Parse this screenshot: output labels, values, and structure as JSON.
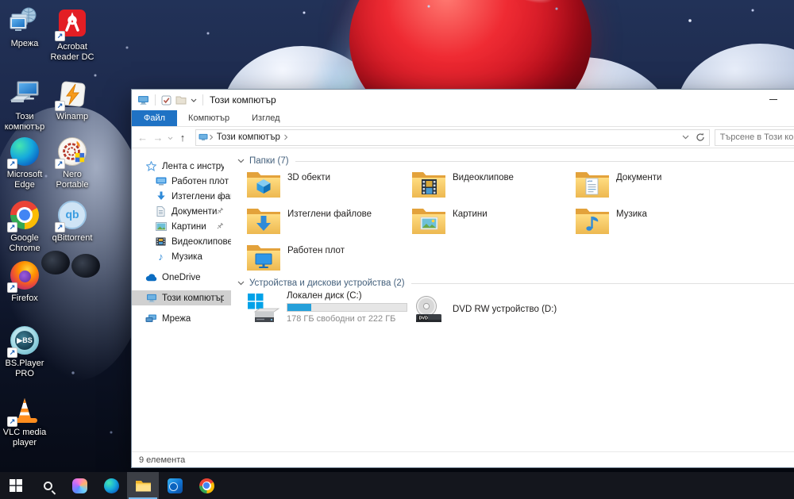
{
  "colors": {
    "accent_blue": "#1f72c4",
    "taskbar_bg": "#14161d",
    "selection_gray": "#d0d0d0",
    "disk_bar_fill": "#26a0da",
    "group_header_text": "#44607c"
  },
  "desktop": {
    "icons": [
      {
        "label": "Мрежа"
      },
      {
        "label": "Acrobat Reader DC"
      },
      {
        "label": "Този компютър"
      },
      {
        "label": "Winamp"
      },
      {
        "label": "Microsoft Edge"
      },
      {
        "label": "Nero Portable"
      },
      {
        "label": "Google Chrome"
      },
      {
        "label": "qBittorrent"
      },
      {
        "label": "Firefox"
      },
      {
        "label": "BS.Player PRO"
      },
      {
        "label": "VLC media player"
      }
    ]
  },
  "window": {
    "title": "Този компютър",
    "tabs": [
      {
        "label": "Файл"
      },
      {
        "label": "Компютър"
      },
      {
        "label": "Изглед"
      }
    ],
    "nav": {
      "breadcrumb_root": "Този компютър",
      "search_placeholder": "Търсене в Този комп"
    },
    "sidebar": {
      "items": [
        {
          "label": "Лента с инструменти"
        },
        {
          "label": "Работен плот",
          "pinned": true
        },
        {
          "label": "Изтеглени файл",
          "pinned": true
        },
        {
          "label": "Документи",
          "pinned": true
        },
        {
          "label": "Картини",
          "pinned": true
        },
        {
          "label": "Видеоклипове"
        },
        {
          "label": "Музика"
        },
        {
          "label": "OneDrive"
        },
        {
          "label": "Този компютър",
          "selected": true
        },
        {
          "label": "Мрежа"
        }
      ]
    },
    "groups": {
      "folders": {
        "header": "Папки (7)",
        "items": [
          {
            "label": "3D обекти"
          },
          {
            "label": "Изтеглени файлове"
          },
          {
            "label": "Работен плот"
          },
          {
            "label": "Видеоклипове"
          },
          {
            "label": "Картини"
          },
          {
            "label": "Документи"
          },
          {
            "label": "Музика"
          }
        ]
      },
      "devices": {
        "header": "Устройства и дискови устройства (2)",
        "drive": {
          "label": "Локален диск (C:)",
          "free_text": "178 ГБ свободни от 222 ГБ",
          "used_percent": 20
        },
        "dvd": {
          "label": "DVD RW устройство (D:)"
        }
      }
    },
    "statusbar": {
      "items_count": "9 елемента"
    }
  },
  "taskbar": {
    "icons": [
      {
        "name": "start"
      },
      {
        "name": "search"
      },
      {
        "name": "copilot"
      },
      {
        "name": "edge"
      },
      {
        "name": "file-explorer",
        "active": true
      },
      {
        "name": "outlook"
      },
      {
        "name": "chrome"
      }
    ]
  }
}
